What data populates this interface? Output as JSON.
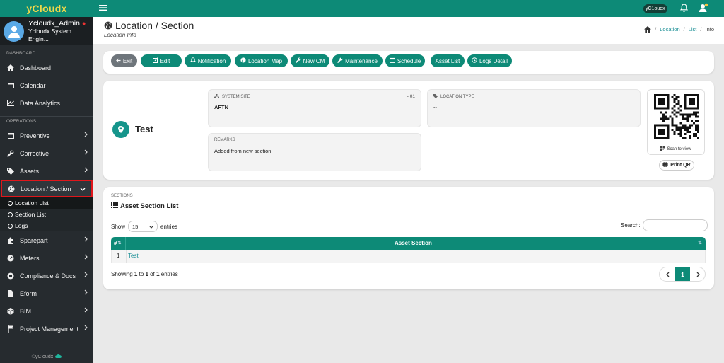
{
  "app": {
    "brand": "yCloudx",
    "footer": "©yCloudx"
  },
  "user": {
    "name": "Ycloudx_Admin",
    "role": "Ycloudx System Engin..."
  },
  "sidebar": {
    "sections": [
      "DASHBOARD",
      "OPERATIONS"
    ],
    "top_items": [
      {
        "label": "Dashboard",
        "icon": "home-icon"
      },
      {
        "label": "Calendar",
        "icon": "calendar-icon"
      },
      {
        "label": "Data Analytics",
        "icon": "line-chart-icon"
      }
    ],
    "ops_items": [
      {
        "label": "Preventive",
        "icon": "calendar-icon"
      },
      {
        "label": "Corrective",
        "icon": "wrench-icon"
      },
      {
        "label": "Assets",
        "icon": "tag-icon"
      },
      {
        "label": "Location / Section",
        "icon": "globe-icon"
      }
    ],
    "sub_items": [
      "Location List",
      "Section List",
      "Logs"
    ],
    "bottom_items": [
      {
        "label": "Sparepart",
        "icon": "puzzle-icon"
      },
      {
        "label": "Meters",
        "icon": "gauge-icon"
      },
      {
        "label": "Compliance & Docs",
        "icon": "book-icon"
      },
      {
        "label": "Eform",
        "icon": "file-icon"
      },
      {
        "label": "BIM",
        "icon": "cube-icon"
      },
      {
        "label": "Project Management",
        "icon": "flag-icon"
      }
    ]
  },
  "topbar": {
    "org_badge": "yC1oudx"
  },
  "page": {
    "title": "Location / Section",
    "subtitle": "Location Info"
  },
  "breadcrumb": [
    "Location",
    "List",
    "Info"
  ],
  "toolbar": {
    "buttons": [
      "Exit",
      "Edit",
      "Notification",
      "Location Map",
      "New CM",
      "Maintenance",
      "Schedule",
      "Asset List",
      "Logs Detail"
    ]
  },
  "location": {
    "name": "Test",
    "system_site_label": "SYSTEM SITE",
    "system_site_code": "- 01",
    "system_site_value": "AFTN",
    "location_type_label": "LOCATION TYPE",
    "location_type_value": "--",
    "remarks_label": "REMARKS",
    "remarks_value": "Added from new section",
    "scan_text": "Scan to view",
    "print_qr": "Print QR"
  },
  "sections": {
    "label": "SECTIONS",
    "title": "Asset Section List",
    "show_label": "Show",
    "entries_value": "15",
    "entries_label": "entries",
    "search_label": "Search:",
    "columns": [
      "#",
      "Asset Section"
    ],
    "rows": [
      {
        "num": "1",
        "name": "Test"
      }
    ],
    "info": {
      "pre": "Showing ",
      "from": "1",
      "mid1": " to ",
      "to": "1",
      "mid2": " of ",
      "total": "1",
      "post": " entries"
    },
    "page": "1"
  }
}
